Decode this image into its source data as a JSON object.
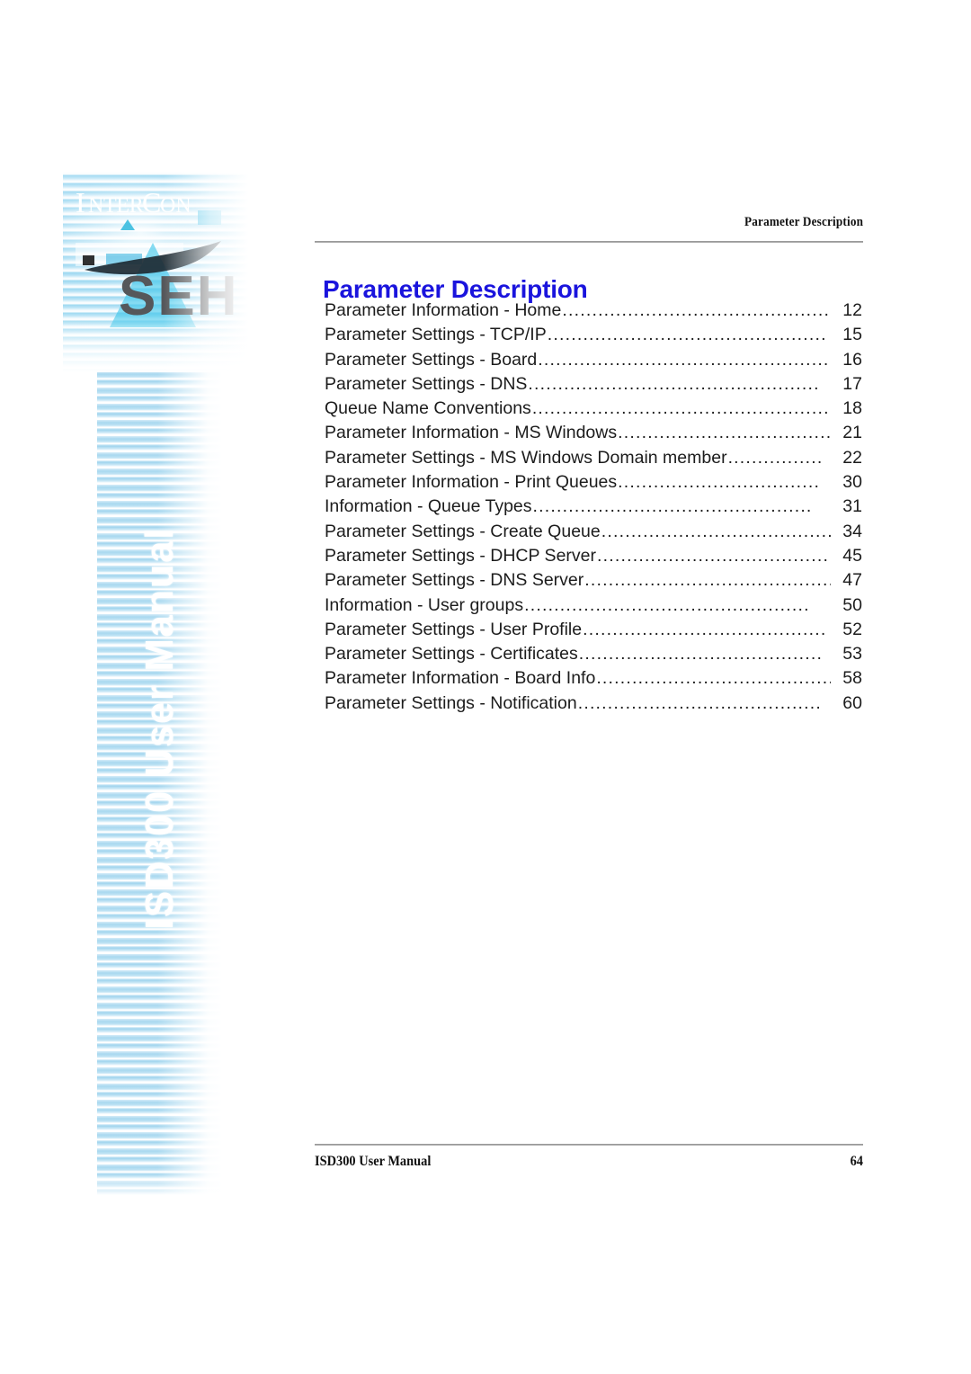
{
  "header": {
    "running_head": "Parameter Description"
  },
  "main": {
    "title": "Parameter Description",
    "toc": [
      {
        "label": "Parameter Information - Home",
        "leader": "..................................................",
        "page": "12"
      },
      {
        "label": "Parameter Settings - TCP/IP ",
        "leader": "...............................................",
        "page": "15"
      },
      {
        "label": "Parameter Settings - Board",
        "leader": "....................................................",
        "page": "16"
      },
      {
        "label": "Parameter Settings - DNS ",
        "leader": ".................................................",
        "page": "17"
      },
      {
        "label": "Queue Name Conventions",
        "leader": "......................................................",
        "page": "18"
      },
      {
        "label": "Parameter Information - MS Windows ",
        "leader": "....................................",
        "page": "21"
      },
      {
        "label": "Parameter Settings - MS Windows Domain member",
        "leader": "................",
        "page": "22"
      },
      {
        "label": "Parameter Information - Print Queues ",
        "leader": "..................................",
        "page": "30"
      },
      {
        "label": "Information - Queue Types ",
        "leader": "...............................................",
        "page": "31"
      },
      {
        "label": "Parameter Settings - Create Queue",
        "leader": ".........................................",
        "page": "34"
      },
      {
        "label": "Parameter Settings - DHCP Server ",
        "leader": ".......................................",
        "page": "45"
      },
      {
        "label": "Parameter Settings - DNS Server",
        "leader": "...........................................",
        "page": "47"
      },
      {
        "label": "Information - User groups ",
        "leader": "................................................",
        "page": "50"
      },
      {
        "label": "Parameter Settings - User Profile ",
        "leader": ".........................................",
        "page": "52"
      },
      {
        "label": "Parameter Settings - Certificates ",
        "leader": ".........................................",
        "page": "53"
      },
      {
        "label": "Parameter Information - Board Info",
        "leader": ".........................................",
        "page": "58"
      },
      {
        "label": "Parameter Settings - Notification ",
        "leader": ".........................................",
        "page": "60"
      }
    ]
  },
  "sidebar": {
    "vertical_title": "ISD300 User Manual",
    "logo": {
      "brand_top": "I",
      "brand_top_full": "INTERCON",
      "brand_bottom": "SEH"
    }
  },
  "footer": {
    "left": "ISD300 User Manual",
    "page_number": "64"
  }
}
